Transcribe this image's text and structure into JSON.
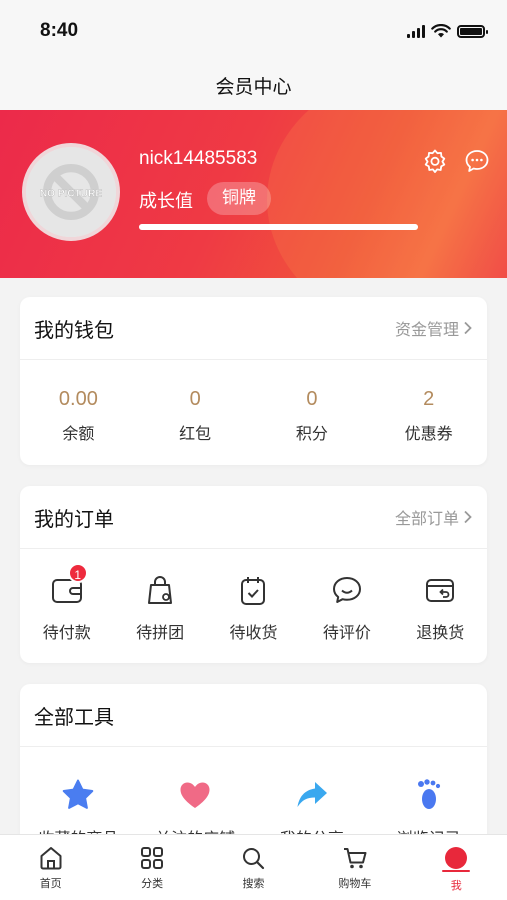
{
  "status_bar": {
    "time": "8:40"
  },
  "nav": {
    "title": "会员中心"
  },
  "profile": {
    "avatar_text": "NO PICTURE",
    "username": "nick14485583",
    "growth_label": "成长值",
    "level_badge": "铜牌",
    "growth_progress": 1.0
  },
  "wallet": {
    "title": "我的钱包",
    "link": "资金管理",
    "stats": [
      {
        "value": "0.00",
        "label": "余额"
      },
      {
        "value": "0",
        "label": "红包"
      },
      {
        "value": "0",
        "label": "积分"
      },
      {
        "value": "2",
        "label": "优惠券"
      }
    ]
  },
  "orders": {
    "title": "我的订单",
    "link": "全部订单",
    "items": [
      {
        "label": "待付款",
        "icon": "wallet-icon",
        "badge": "1"
      },
      {
        "label": "待拼团",
        "icon": "group-bag-icon"
      },
      {
        "label": "待收货",
        "icon": "receive-icon"
      },
      {
        "label": "待评价",
        "icon": "comment-icon"
      },
      {
        "label": "退换货",
        "icon": "return-icon"
      }
    ]
  },
  "tools": {
    "title": "全部工具",
    "items": [
      {
        "label": "收藏的商品",
        "icon": "star-icon",
        "color": "#4a7df0"
      },
      {
        "label": "关注的店铺",
        "icon": "heart-icon",
        "color": "#f06a86"
      },
      {
        "label": "我的分享",
        "icon": "share-arrow-icon",
        "color": "#3aa8ef"
      },
      {
        "label": "浏览记录",
        "icon": "footprint-icon",
        "color": "#4a78f0"
      }
    ]
  },
  "tabbar": {
    "items": [
      {
        "label": "首页",
        "icon": "home-icon"
      },
      {
        "label": "分类",
        "icon": "category-icon"
      },
      {
        "label": "搜索",
        "icon": "search-icon"
      },
      {
        "label": "购物车",
        "icon": "cart-icon"
      },
      {
        "label": "我",
        "icon": "me-icon",
        "active": true
      }
    ]
  },
  "colors": {
    "brand_red": "#e8283b",
    "stat_gold": "#b38b5e"
  }
}
